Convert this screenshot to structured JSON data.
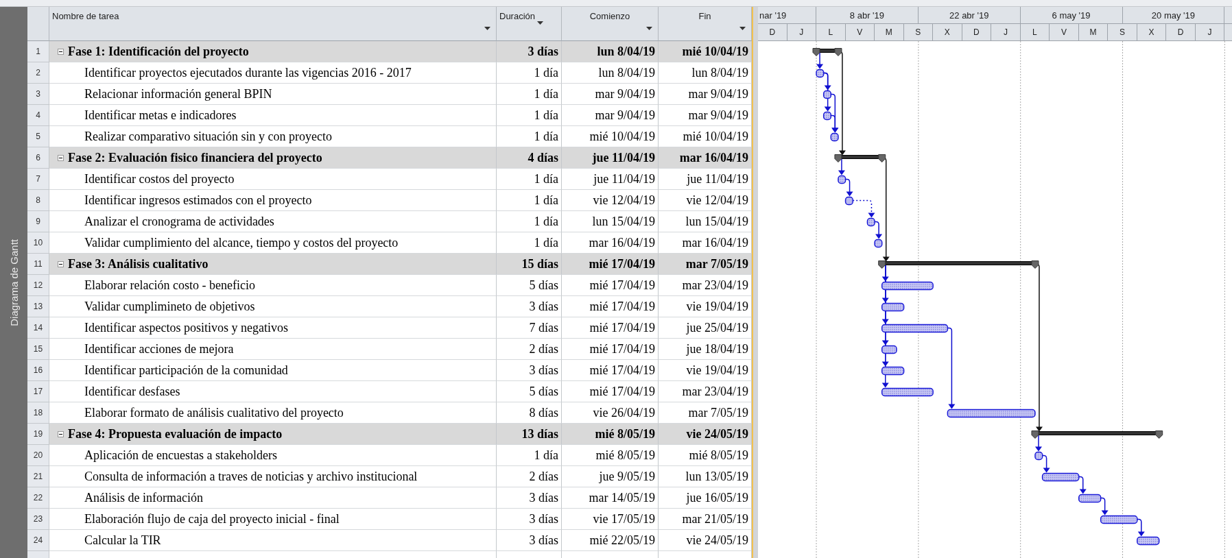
{
  "view_bar": {
    "label": "Diagrama de Gantt"
  },
  "columns": [
    {
      "label": "Nombre de tarea"
    },
    {
      "label": "Duración"
    },
    {
      "label": "Comienzo"
    },
    {
      "label": "Fin"
    }
  ],
  "timescale": {
    "major": [
      "nar '19",
      "8 abr '19",
      "22 abr '19",
      "6 may '19",
      "20 may '19"
    ],
    "minor": [
      "D",
      "J",
      "L",
      "V",
      "M",
      "S",
      "X",
      "D",
      "J",
      "L",
      "V",
      "M",
      "S",
      "X",
      "D",
      "J"
    ]
  },
  "tasks": [
    {
      "id": "1",
      "kind": "summary",
      "expanded": true,
      "name": "Fase 1: Identificación del proyecto",
      "duration": "3 días",
      "start": "lun 8/04/19",
      "finish": "mié 10/04/19",
      "children": [
        {
          "id": "2",
          "kind": "task",
          "name": "Identificar proyectos ejecutados durante las vigencias 2016 - 2017",
          "duration": "1 día",
          "start": "lun 8/04/19",
          "finish": "lun 8/04/19"
        },
        {
          "id": "3",
          "kind": "task",
          "name": "Relacionar información general BPIN",
          "duration": "1 día",
          "start": "mar 9/04/19",
          "finish": "mar 9/04/19"
        },
        {
          "id": "4",
          "kind": "task",
          "name": "Identificar metas e indicadores",
          "duration": "1 día",
          "start": "mar 9/04/19",
          "finish": "mar 9/04/19"
        },
        {
          "id": "5",
          "kind": "task",
          "name": "Realizar comparativo situación sin y con proyecto",
          "duration": "1 día",
          "start": "mié 10/04/19",
          "finish": "mié 10/04/19"
        }
      ]
    },
    {
      "id": "6",
      "kind": "summary",
      "expanded": true,
      "name": "Fase 2: Evaluación fisico financiera del proyecto",
      "duration": "4 días",
      "start": "jue 11/04/19",
      "finish": "mar 16/04/19",
      "children": [
        {
          "id": "7",
          "kind": "task",
          "name": "Identificar costos del proyecto",
          "duration": "1 día",
          "start": "jue 11/04/19",
          "finish": "jue 11/04/19"
        },
        {
          "id": "8",
          "kind": "task",
          "name": "Identificar ingresos estimados con el proyecto",
          "duration": "1 día",
          "start": "vie 12/04/19",
          "finish": "vie 12/04/19"
        },
        {
          "id": "9",
          "kind": "task",
          "name": "Analizar el cronograma de actividades",
          "duration": "1 día",
          "start": "lun 15/04/19",
          "finish": "lun 15/04/19"
        },
        {
          "id": "10",
          "kind": "task",
          "name": "Validar cumplimiento del alcance, tiempo y costos del proyecto",
          "duration": "1 día",
          "start": "mar 16/04/19",
          "finish": "mar 16/04/19"
        }
      ]
    },
    {
      "id": "11",
      "kind": "summary",
      "expanded": true,
      "name": "Fase 3: Análisis cualitativo",
      "duration": "15 días",
      "start": "mié 17/04/19",
      "finish": "mar 7/05/19",
      "children": [
        {
          "id": "12",
          "kind": "task",
          "name": "Elaborar relación costo - beneficio",
          "duration": "5 días",
          "start": "mié 17/04/19",
          "finish": "mar 23/04/19"
        },
        {
          "id": "13",
          "kind": "task",
          "name": "Validar cumplimineto de objetivos",
          "duration": "3 días",
          "start": "mié 17/04/19",
          "finish": "vie 19/04/19"
        },
        {
          "id": "14",
          "kind": "task",
          "name": "Identificar aspectos positivos y negativos",
          "duration": "7 días",
          "start": "mié 17/04/19",
          "finish": "jue 25/04/19"
        },
        {
          "id": "15",
          "kind": "task",
          "name": "Identificar acciones de mejora",
          "duration": "2 días",
          "start": "mié 17/04/19",
          "finish": "jue 18/04/19"
        },
        {
          "id": "16",
          "kind": "task",
          "name": "Identificar participación de la comunidad",
          "duration": "3 días",
          "start": "mié 17/04/19",
          "finish": "vie 19/04/19"
        },
        {
          "id": "17",
          "kind": "task",
          "name": "Identificar desfases",
          "duration": "5 días",
          "start": "mié 17/04/19",
          "finish": "mar 23/04/19"
        },
        {
          "id": "18",
          "kind": "task",
          "name": "Elaborar formato de análisis cualitativo del proyecto",
          "duration": "8 días",
          "start": "vie 26/04/19",
          "finish": "mar 7/05/19"
        }
      ]
    },
    {
      "id": "19",
      "kind": "summary",
      "expanded": true,
      "name": "Fase 4: Propuesta evaluación de impacto",
      "duration": "13 días",
      "start": "mié 8/05/19",
      "finish": "vie 24/05/19",
      "children": [
        {
          "id": "20",
          "kind": "task",
          "name": "Aplicación de encuestas a stakeholders",
          "duration": "1 día",
          "start": "mié 8/05/19",
          "finish": "mié 8/05/19"
        },
        {
          "id": "21",
          "kind": "task",
          "name": "Consulta de información a traves de noticias y archivo institucional",
          "duration": "2 días",
          "start": "jue 9/05/19",
          "finish": "lun 13/05/19"
        },
        {
          "id": "22",
          "kind": "task",
          "name": "Análisis de información",
          "duration": "3 días",
          "start": "mar 14/05/19",
          "finish": "jue 16/05/19"
        },
        {
          "id": "23",
          "kind": "task",
          "name": "Elaboración flujo de caja del proyecto inicial - final",
          "duration": "3 días",
          "start": "vie 17/05/19",
          "finish": "mar 21/05/19"
        },
        {
          "id": "24",
          "kind": "task",
          "name": "Calcular la TIR",
          "duration": "3 días",
          "start": "mié 22/05/19",
          "finish": "vie 24/05/19"
        }
      ]
    }
  ]
}
